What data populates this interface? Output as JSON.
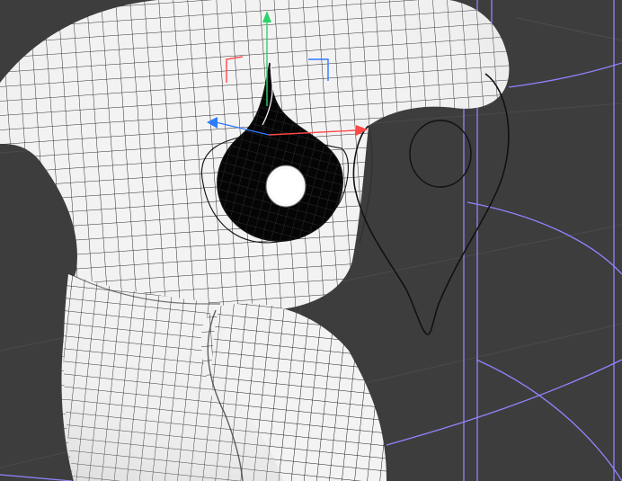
{
  "viewport": {
    "background": "#3d3d3d",
    "grid_color": "#4a4a4a",
    "mesh_fill": "#f3f3f3",
    "mesh_line": "#1a1a1a",
    "boundary_line": "#8f84ff"
  },
  "gizmo": {
    "x_axis_color": "#ff4848",
    "y_axis_color": "#2fd36b",
    "z_axis_color": "#2d7bff",
    "mode": "move"
  },
  "selection": {
    "object": "eye-hole-cutout",
    "outline_color": "#111111"
  }
}
